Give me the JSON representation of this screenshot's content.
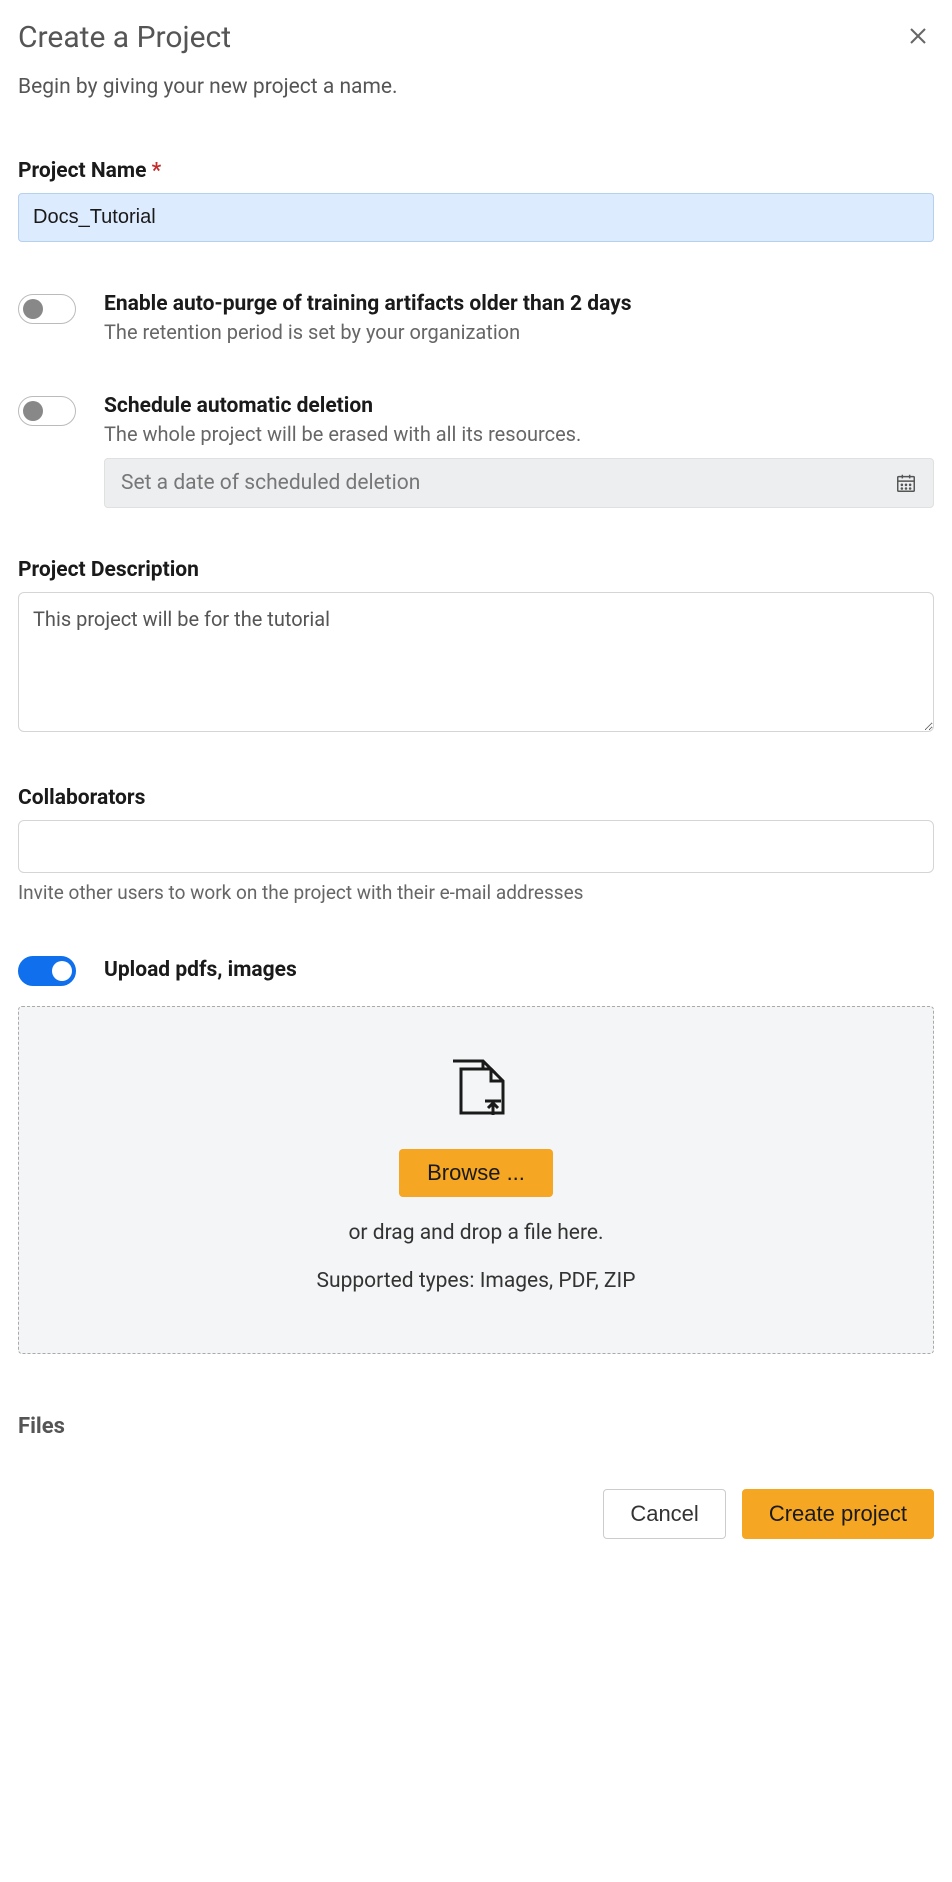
{
  "dialog": {
    "title": "Create a Project",
    "subtitle": "Begin by giving your new project a name."
  },
  "projectName": {
    "label": "Project Name",
    "required_marker": "*",
    "value": "Docs_Tutorial"
  },
  "autoPurge": {
    "title": "Enable auto-purge of training artifacts older than 2 days",
    "description": "The retention period is set by your organization",
    "enabled": false
  },
  "scheduledDeletion": {
    "title": "Schedule automatic deletion",
    "description": "The whole project will be erased with all its resources.",
    "enabled": false,
    "date_placeholder": "Set a date of scheduled deletion"
  },
  "description": {
    "label": "Project Description",
    "value": "This project will be for the tutorial"
  },
  "collaborators": {
    "label": "Collaborators",
    "value": "",
    "helper": "Invite other users to work on the project with their e-mail addresses"
  },
  "uploads": {
    "toggle_label": "Upload pdfs, images",
    "enabled": true,
    "browse_label": "Browse ...",
    "dragdrop_text": "or drag and drop a file here.",
    "supported_text": "Supported types: Images, PDF, ZIP"
  },
  "files": {
    "heading": "Files"
  },
  "footer": {
    "cancel_label": "Cancel",
    "create_label": "Create project"
  }
}
